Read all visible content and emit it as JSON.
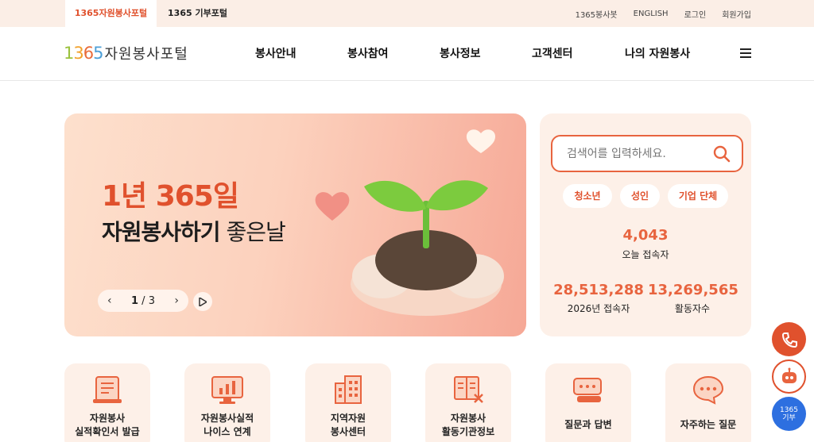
{
  "topbar": {
    "tabs": [
      "1365자원봉사포털",
      "1365 기부포털"
    ],
    "links": [
      "1365봉사봇",
      "ENGLISH",
      "로그인",
      "회원가입"
    ]
  },
  "header": {
    "logo_number": "1365",
    "logo_text": "자원봉사포털",
    "nav": [
      "봉사안내",
      "봉사참여",
      "봉사정보",
      "고객센터",
      "나의 자원봉사"
    ]
  },
  "banner": {
    "line1": "1년 365일",
    "line2_bold": "자원봉사하기",
    "line2_rest": " 좋은날",
    "page_current": "1",
    "page_separator": " / ",
    "page_total": "3"
  },
  "search": {
    "placeholder": "검색어를 입력하세요.",
    "chips": [
      "청소년",
      "성인",
      "기업 단체"
    ]
  },
  "stats": {
    "today_value": "4,043",
    "today_label": "오늘 접속자",
    "year_value": "28,513,288",
    "year_label": "2026년 접속자",
    "active_value": "13,269,565",
    "active_label": "활동자수"
  },
  "cards": [
    {
      "line1": "자원봉사",
      "line2": "실적확인서 발급",
      "icon": "certificate-icon"
    },
    {
      "line1": "자원봉사실적",
      "line2": "나이스 연계",
      "icon": "monitor-chart-icon"
    },
    {
      "line1": "지역자원",
      "line2": "봉사센터",
      "icon": "building-icon"
    },
    {
      "line1": "자원봉사",
      "line2": "활동기관정보",
      "icon": "org-info-icon"
    },
    {
      "line1": "질문과 답변",
      "line2": "",
      "icon": "qna-icon"
    },
    {
      "line1": "자주하는 질문",
      "line2": "",
      "icon": "faq-icon"
    }
  ],
  "fab": {
    "donate_line1": "1365",
    "donate_line2": "기부"
  },
  "colors": {
    "accent": "#e0512d",
    "accent_light": "#e8643f",
    "panel_bg": "#fdf0e8",
    "topbar_bg": "#fbeee6"
  }
}
